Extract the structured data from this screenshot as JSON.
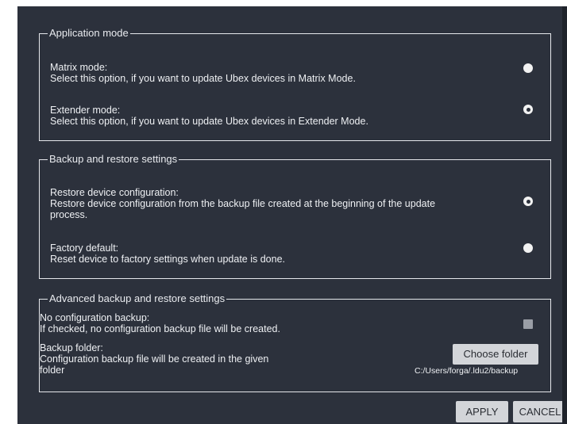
{
  "application_mode": {
    "legend": "Application mode",
    "matrix": {
      "title": "Matrix mode:",
      "desc": "Select this option, if you want to update Ubex devices in Matrix Mode.",
      "selected": false
    },
    "extender": {
      "title": "Extender mode:",
      "desc": "Select this option, if you want to update Ubex devices in Extender Mode.",
      "selected": true
    }
  },
  "backup_restore": {
    "legend": "Backup and restore settings",
    "restore": {
      "title": "Restore device configuration:",
      "desc_line1": "Restore device configuration from the backup file created at the beginning of the update",
      "desc_line2": "process.",
      "selected": true
    },
    "factory": {
      "title": "Factory default:",
      "desc": "Reset device to factory settings when update is done.",
      "selected": false
    }
  },
  "advanced": {
    "legend": "Advanced backup and restore settings",
    "no_backup": {
      "title": "No configuration backup:",
      "desc": "If checked, no configuration backup file will be created.",
      "checked": false
    },
    "folder": {
      "title": "Backup folder:",
      "desc_line1": "Configuration backup file will be created in the given",
      "desc_line2": "folder",
      "button": "Choose folder",
      "path": "C:/Users/forga/.ldu2/backup"
    }
  },
  "footer": {
    "apply": "APPLY",
    "cancel": "CANCEL"
  }
}
